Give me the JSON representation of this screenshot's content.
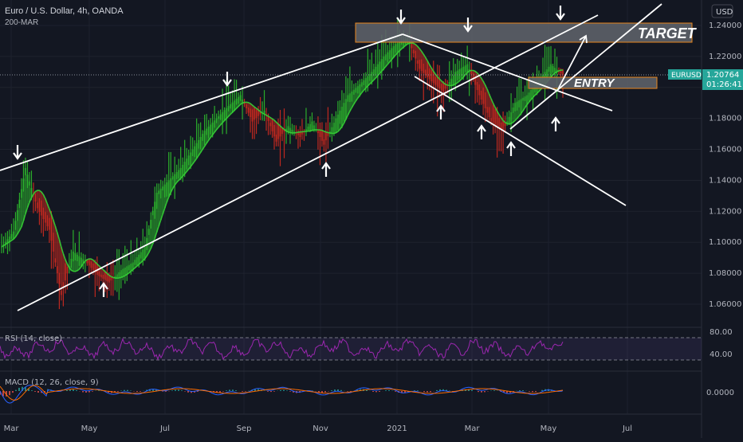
{
  "header": {
    "title": "Euro / U.S. Dollar, 4h, OANDA",
    "indicator": "200-MAR",
    "currency_button": "USD"
  },
  "price_tag": {
    "symbol": "EURUSD",
    "price": "1.20764",
    "countdown": "01:26:41"
  },
  "annotations": {
    "target": "TARGET",
    "entry": "ENTRY"
  },
  "panes": {
    "rsi_label": "RSI (14, close)",
    "macd_label": "MACD (12, 26, close, 9)",
    "rsi_ticks": [
      "80.00",
      "40.00"
    ],
    "macd_ticks": [
      "0.0000"
    ]
  },
  "colors": {
    "bull": "#2dbd2d",
    "bear": "#d12a1f",
    "line": "#ffffff",
    "box_border": "#e8861d",
    "price_tag": "#26a69a",
    "rsi": "#9c27b0"
  },
  "chart_data": {
    "type": "line",
    "price_axis_ticks": [
      "1.24000",
      "1.22000",
      "1.20000",
      "1.18000",
      "1.16000",
      "1.14000",
      "1.12000",
      "1.10000",
      "1.08000",
      "1.06000"
    ],
    "x_ticks": [
      "Mar",
      "May",
      "Jul",
      "Sep",
      "Nov",
      "2021",
      "Mar",
      "May",
      "Jul"
    ],
    "series": [
      {
        "values": [
          1.097,
          1.107,
          1.148,
          1.122,
          1.108,
          1.066,
          1.094,
          1.088,
          1.079,
          1.074,
          1.082,
          1.087,
          1.097,
          1.132,
          1.14,
          1.148,
          1.16,
          1.172,
          1.18,
          1.188,
          1.195,
          1.178,
          1.185,
          1.165,
          1.175,
          1.168,
          1.178,
          1.163,
          1.18,
          1.195,
          1.202,
          1.21,
          1.22,
          1.228,
          1.232,
          1.212,
          1.204,
          1.197,
          1.21,
          1.215,
          1.195,
          1.178,
          1.172,
          1.19,
          1.195,
          1.205,
          1.215,
          1.208
        ]
      }
    ],
    "ylim": [
      1.05,
      1.25
    ]
  }
}
